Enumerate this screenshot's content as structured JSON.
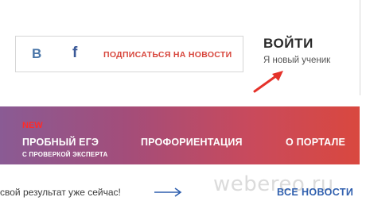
{
  "header": {
    "social": {
      "vk_icon": "vk-icon",
      "vk_glyph": "B",
      "fb_icon": "facebook-icon",
      "fb_glyph": "f",
      "subscribe_label": "ПОДПИСАТЬСЯ НА НОВОСТИ"
    },
    "login_label": "ВОЙТИ",
    "new_student_label": "Я новый ученик"
  },
  "nav": {
    "ege": {
      "badge": "NEW",
      "label": "ПРОБНЫЙ ЕГЭ",
      "sublabel": "С ПРОВЕРКОЙ ЭКСПЕРТА"
    },
    "career_label": "ПРОФОРИЕНТАЦИЯ",
    "portal_label": "О ПОРТАЛЕ"
  },
  "promo": {
    "text": "свой результат уже сейчас!",
    "all_news_label": "ВСЕ НОВОСТИ"
  },
  "watermark": "webereo.ru",
  "colors": {
    "accent_red": "#d7443a",
    "accent_blue": "#2f5fae",
    "vk_blue": "#4a76a8",
    "fb_blue": "#3b5998",
    "badge_red": "#ff2a2a"
  }
}
